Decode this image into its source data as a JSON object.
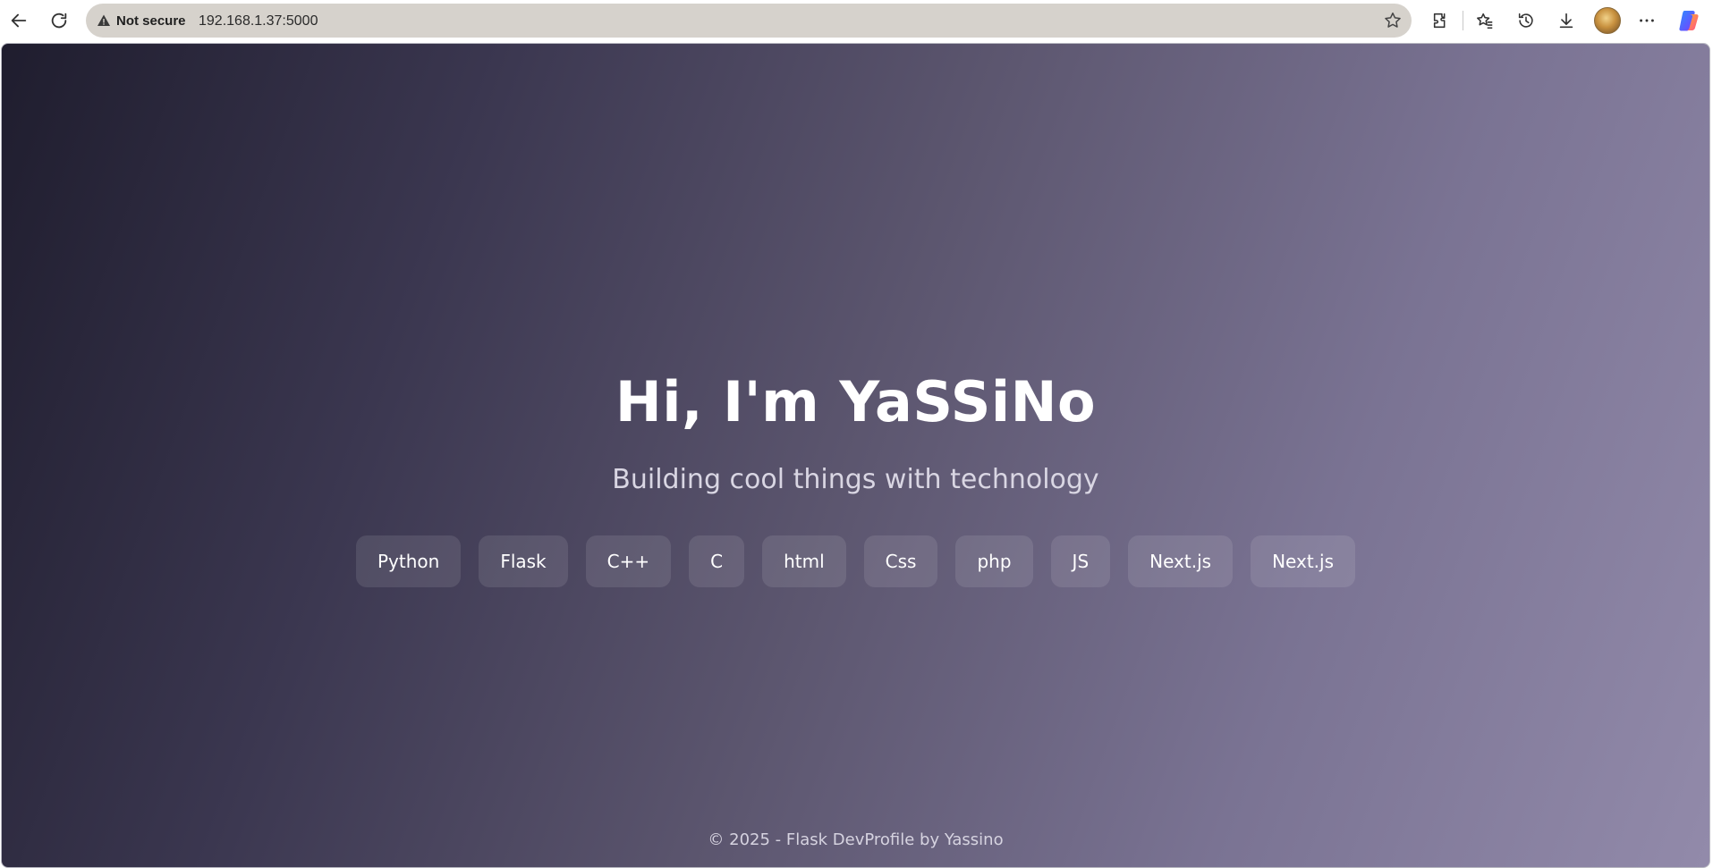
{
  "browser": {
    "security_label": "Not secure",
    "url": "192.168.1.37:5000",
    "icons": [
      "back-icon",
      "refresh-icon",
      "warning-icon",
      "favorite-star-icon",
      "extensions-icon",
      "favorites-icon",
      "history-icon",
      "download-icon",
      "profile-avatar",
      "more-icon",
      "copilot-icon"
    ]
  },
  "page": {
    "title": "Hi, I'm YaSSiNo",
    "subtitle": "Building cool things with technology",
    "skills": [
      "Python",
      "Flask",
      "C++",
      "C",
      "html",
      "Css",
      "php",
      "JS",
      "Next.js",
      "Next.js"
    ],
    "footer": "© 2025 - Flask DevProfile by Yassino"
  },
  "colors": {
    "gradient_start": "#1f1d2e",
    "gradient_end": "#928aaa",
    "url_bar": "#d6d2cc"
  }
}
